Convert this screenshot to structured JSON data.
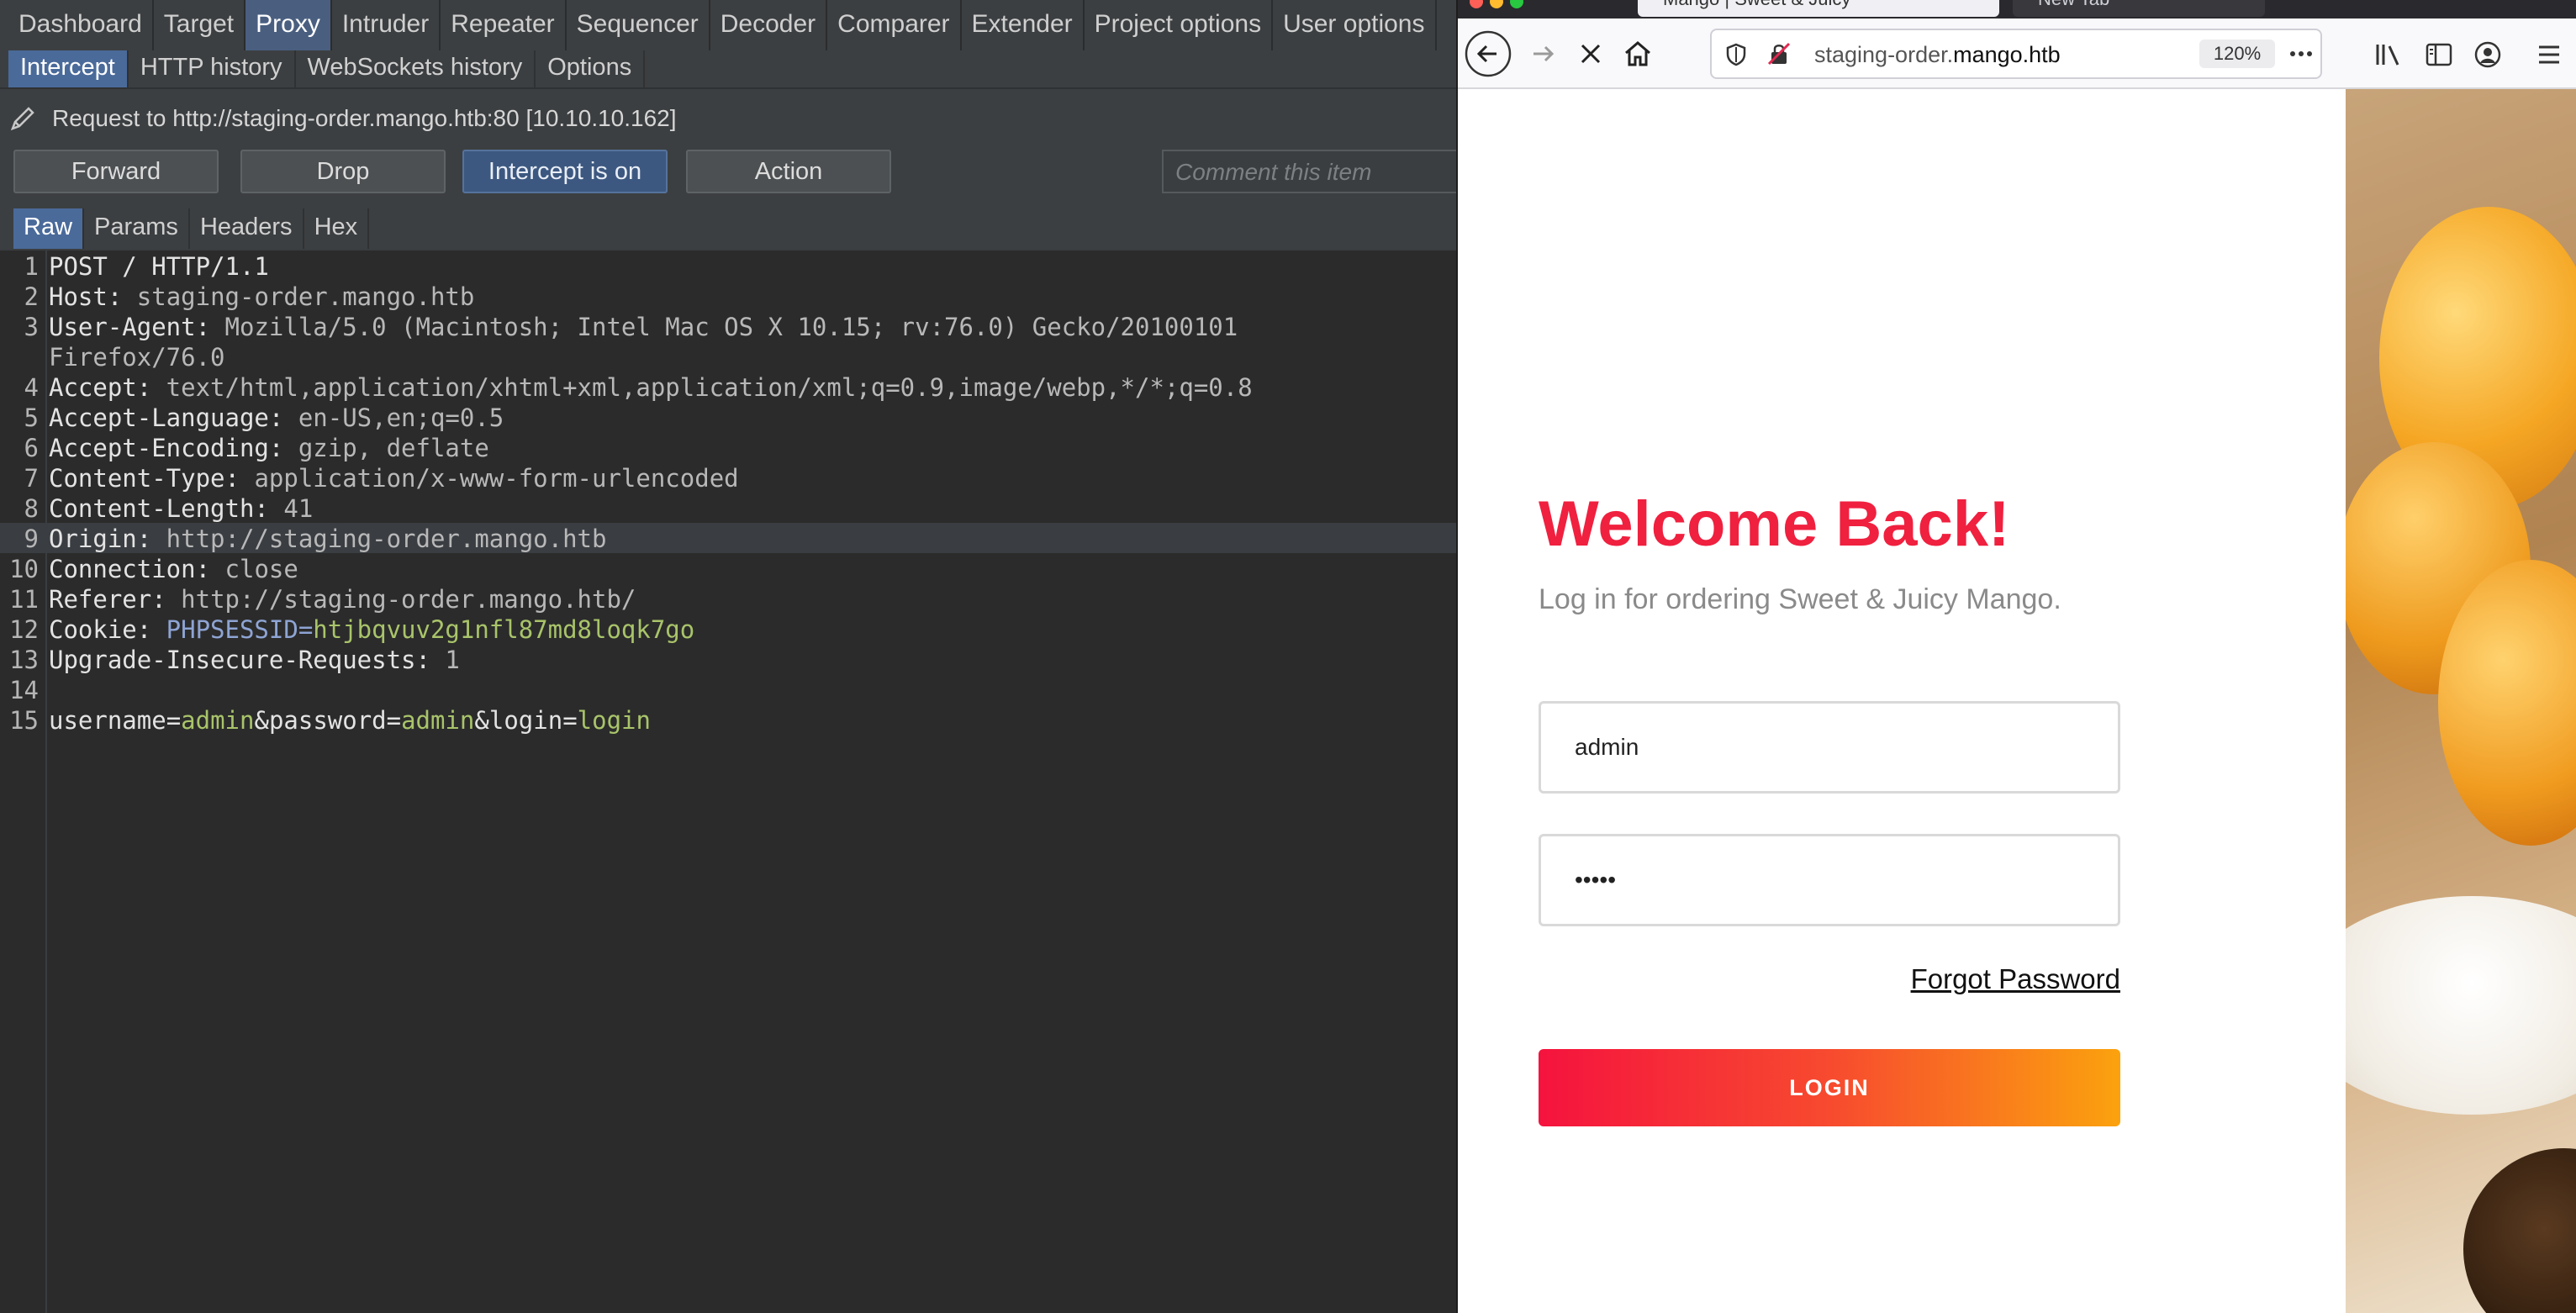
{
  "burp": {
    "main_tabs": [
      "Dashboard",
      "Target",
      "Proxy",
      "Intruder",
      "Repeater",
      "Sequencer",
      "Decoder",
      "Comparer",
      "Extender",
      "Project options",
      "User options"
    ],
    "proxy_tabs": [
      "Intercept",
      "HTTP history",
      "WebSockets history",
      "Options"
    ],
    "request_target": "Request to http://staging-order.mango.htb:80  [10.10.10.162]",
    "buttons": {
      "forward": "Forward",
      "drop": "Drop",
      "intercept": "Intercept is on",
      "action": "Action"
    },
    "comment_placeholder": "Comment this item",
    "editor_tabs": [
      "Raw",
      "Params",
      "Headers",
      "Hex"
    ],
    "request_lines": [
      {
        "n": "1",
        "text": "POST / HTTP/1.1"
      },
      {
        "n": "2",
        "key": "Host:",
        "val": " staging-order.mango.htb"
      },
      {
        "n": "3",
        "key": "User-Agent:",
        "val": " Mozilla/5.0 (Macintosh; Intel Mac OS X 10.15; rv:76.0) Gecko/20100101"
      },
      {
        "n": "",
        "val": "Firefox/76.0"
      },
      {
        "n": "4",
        "key": "Accept:",
        "val": " text/html,application/xhtml+xml,application/xml;q=0.9,image/webp,*/*;q=0.8"
      },
      {
        "n": "5",
        "key": "Accept-Language:",
        "val": " en-US,en;q=0.5"
      },
      {
        "n": "6",
        "key": "Accept-Encoding:",
        "val": " gzip, deflate"
      },
      {
        "n": "7",
        "key": "Content-Type:",
        "val": " application/x-www-form-urlencoded"
      },
      {
        "n": "8",
        "key": "Content-Length:",
        "val": " 41"
      },
      {
        "n": "9",
        "key": "Origin:",
        "val": " http://staging-order.mango.htb"
      },
      {
        "n": "10",
        "key": "Connection:",
        "val": " close"
      },
      {
        "n": "11",
        "key": "Referer:",
        "val": " http://staging-order.mango.htb/"
      },
      {
        "n": "12",
        "key": "Cookie:",
        "cookie_name": " PHPSESSID=",
        "cookie_val": "htjbqvuv2g1nfl87md8loqk7go"
      },
      {
        "n": "13",
        "key": "Upgrade-Insecure-Requests:",
        "val": " 1"
      },
      {
        "n": "14",
        "text": ""
      },
      {
        "n": "15",
        "body": [
          [
            "username",
            "="
          ],
          [
            "admin",
            "&"
          ],
          [
            "password",
            "="
          ],
          [
            "admin",
            "&"
          ],
          [
            "login",
            "="
          ],
          [
            "login",
            ""
          ]
        ]
      }
    ]
  },
  "browser": {
    "tabs": [
      "Mango | Sweet & Juicy",
      "New Tab"
    ],
    "url_prefix": "staging-order.",
    "url_domain": "mango.htb",
    "zoom": "120%",
    "page": {
      "title": "Welcome Back!",
      "subtitle": "Log in for ordering Sweet & Juicy Mango.",
      "username_value": "admin",
      "password_value": "•••••",
      "forgot": "Forgot Password",
      "login": "LOGIN"
    }
  },
  "colors": {
    "burp_bg": "#3c3f41",
    "editor_bg": "#2b2b2b",
    "accent_blue": "#4a6a9a",
    "title_red": "#f0203f",
    "login_gradient_start": "#f5133e",
    "login_gradient_end": "#fba20e"
  }
}
